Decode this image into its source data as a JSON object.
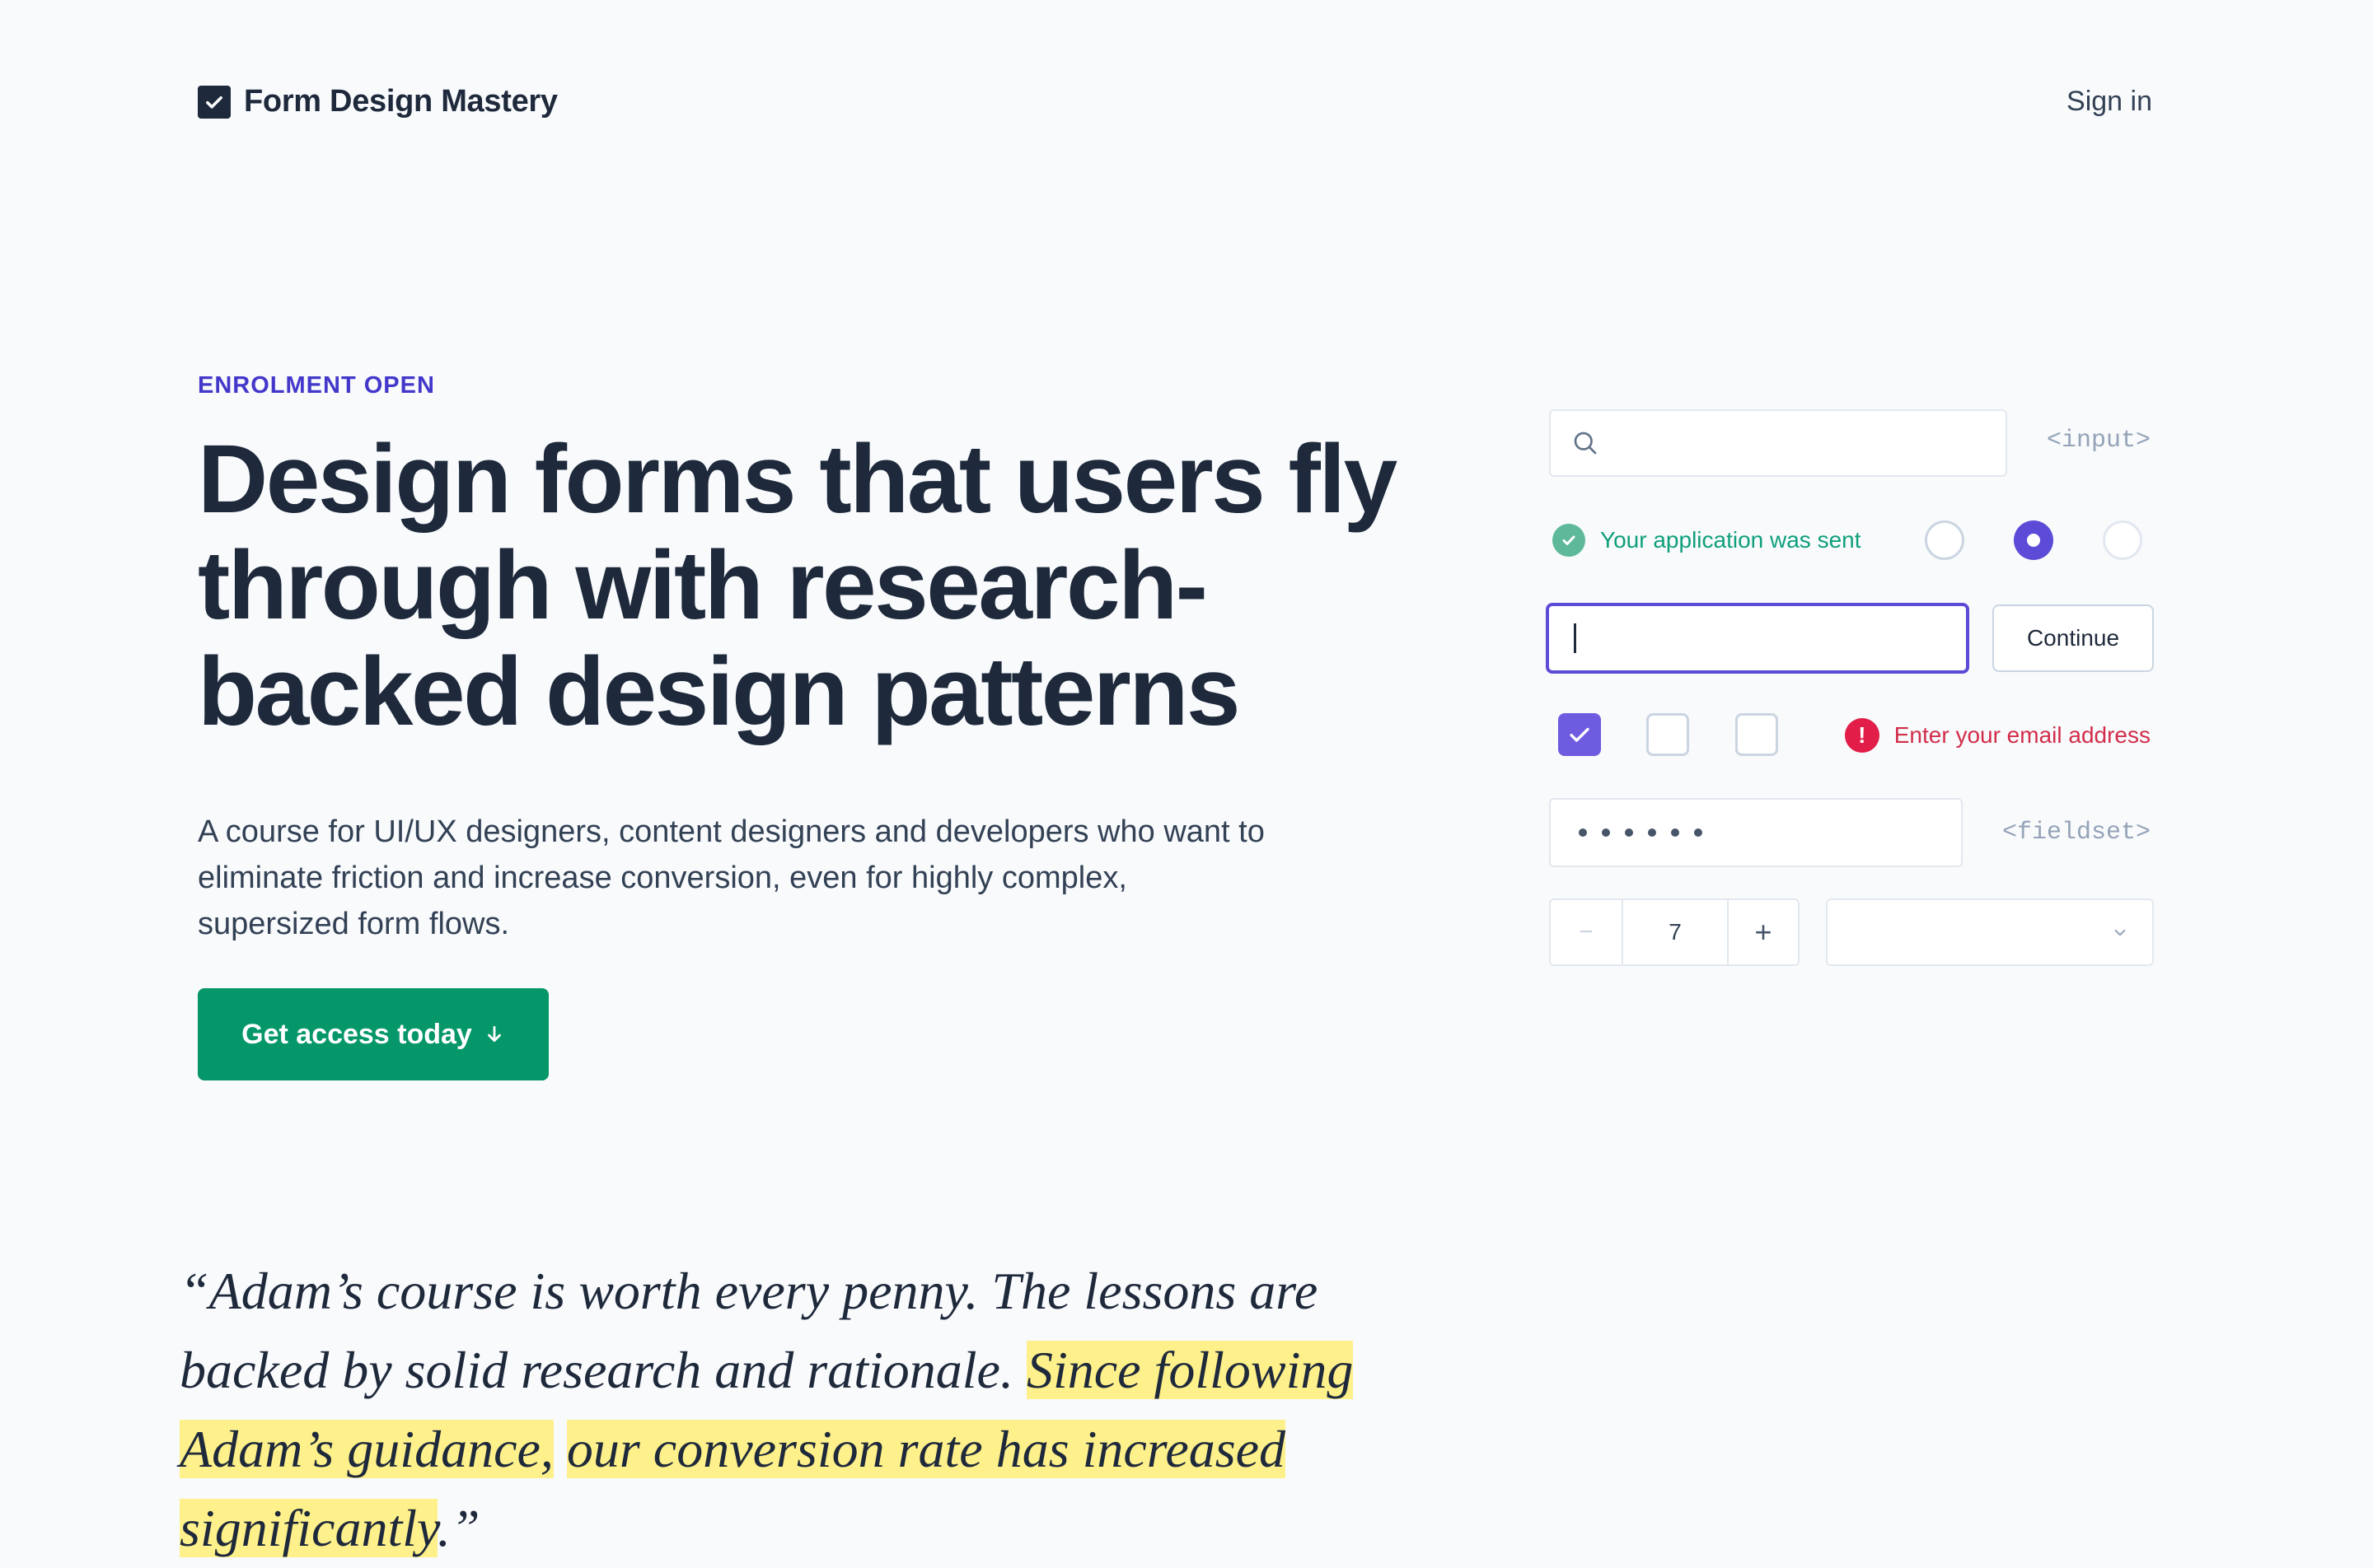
{
  "header": {
    "brand": "Form Design Mastery",
    "sign_in_label": "Sign in"
  },
  "hero": {
    "eyebrow": "ENROLMENT OPEN",
    "headline": "Design forms that users fly through with research-backed design patterns",
    "lead": "A course for UI/UX designers, content designers and developers who want to eliminate friction and increase conversion, even for highly complex, supersized form flows.",
    "cta_label": "Get access today"
  },
  "quote": {
    "open": "“",
    "plain": "Adam’s course is worth every penny. The lessons are backed by solid research and rationale. ",
    "highlight_1": "Since following Adam’s guidance,",
    "space": " ",
    "highlight_2": "our conversion rate has increased significantly",
    "close": ".”"
  },
  "showcase": {
    "input_tag": "<input>",
    "success_message": "Your application was sent",
    "continue_label": "Continue",
    "error_message": "Enter your email address",
    "fieldset_tag": "<fieldset>",
    "stepper": {
      "minus": "−",
      "value": "7",
      "plus": "+"
    },
    "radios": [
      {
        "checked": false
      },
      {
        "checked": true
      },
      {
        "checked": false
      }
    ],
    "checkboxes": [
      {
        "checked": true
      },
      {
        "checked": false
      },
      {
        "checked": false
      }
    ],
    "password_dot_count": 6
  },
  "icons": {
    "logo": "checkbox-logo-icon",
    "search": "search-icon",
    "success": "check-circle-icon",
    "error": "exclamation-circle-icon",
    "cta": "arrow-down-icon",
    "select": "chevron-down-icon"
  },
  "colors": {
    "accent_purple": "#5b4bd6",
    "cta_green": "#059669",
    "success_green": "#0f9f7b",
    "error_red": "#d22d4a",
    "highlight_yellow": "#fef08a"
  }
}
